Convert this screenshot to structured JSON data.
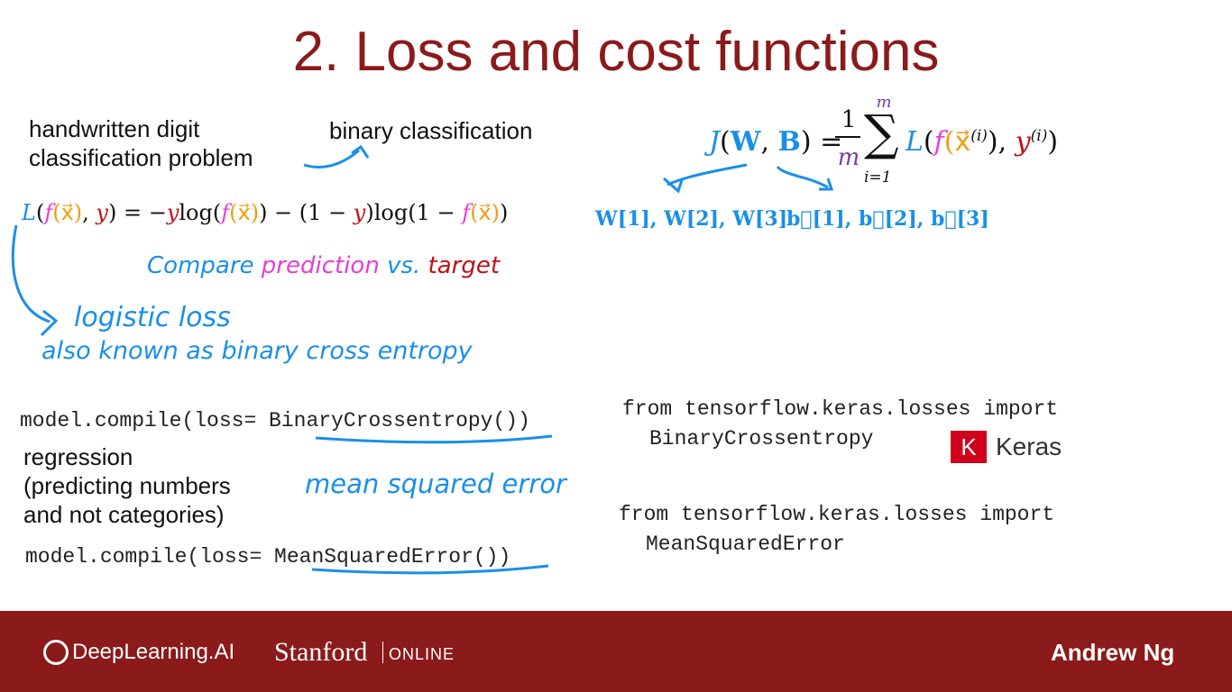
{
  "slide": {
    "title": "2. Loss and cost functions"
  },
  "left": {
    "problem_line1": "handwritten digit",
    "problem_line2": "classification problem",
    "binary_label": "binary classification",
    "loss_formula": {
      "L": "L",
      "lp": "(",
      "f1": "f",
      "x1": "(x⃗)",
      "comma": ", ",
      "y1": "y",
      "rp": ") = −",
      "y2": "y",
      "log1": "log(",
      "f2": "f",
      "x2": "(x⃗)",
      "mid": ") − (1 − ",
      "y3": "y",
      "log2": ")log(1 − ",
      "f3": "f",
      "x3": "(x⃗)",
      "end": ")"
    },
    "hand_compare": "Compare",
    "hand_prediction": "prediction",
    "hand_vs": "vs.",
    "hand_target": "target",
    "hand_logistic": "logistic loss",
    "hand_also": "also known as binary cross entropy",
    "code_binary_prefix": "model.compile(loss= ",
    "code_binary_fn": "BinaryCrossentropy",
    "code_binary_suffix": "())",
    "regression_line1": "regression",
    "regression_line2": "(predicting numbers",
    "regression_line3": "and not categories)",
    "hand_mse": "mean squared error",
    "code_mse_prefix": "model.compile(loss= ",
    "code_mse_fn": "MeanSquaredError",
    "code_mse_suffix": "())"
  },
  "right": {
    "cost_formula": {
      "J": "J",
      "lp": "(",
      "W": "W",
      "comma": ", ",
      "B": "B",
      "eq": ") = ",
      "frac_num": "1",
      "frac_den": "m",
      "sum_top": "m",
      "sum_sym": "∑",
      "sum_bot": "i=1",
      "L": "L",
      "open": "(",
      "f": "f",
      "x": "(x⃗",
      "xi": "(i)",
      "close_x": "), ",
      "y": "y",
      "yi": "(i)",
      "end": ")"
    },
    "weights": "W[1], W[2], W[3]",
    "biases": "b⃗[1], b⃗[2], b⃗[3]",
    "import1_line1": "from tensorflow.keras.losses import",
    "import1_line2": "BinaryCrossentropy",
    "keras_logo": "K",
    "keras_label": "Keras",
    "import2_line1": "from tensorflow.keras.losses import",
    "import2_line2": "MeanSquaredError"
  },
  "footer": {
    "deeplearning": "DeepLearning.AI",
    "stanford": "Stanford",
    "online": "ONLINE",
    "author": "Andrew Ng"
  },
  "colors": {
    "title": "#8b1a1a",
    "footer_bg": "#8b1a1a",
    "annotation_blue": "#1a8fe8",
    "pink": "#e53fd8",
    "red": "#c0101a",
    "orange": "#f39c12",
    "keras_red": "#d0021b"
  }
}
